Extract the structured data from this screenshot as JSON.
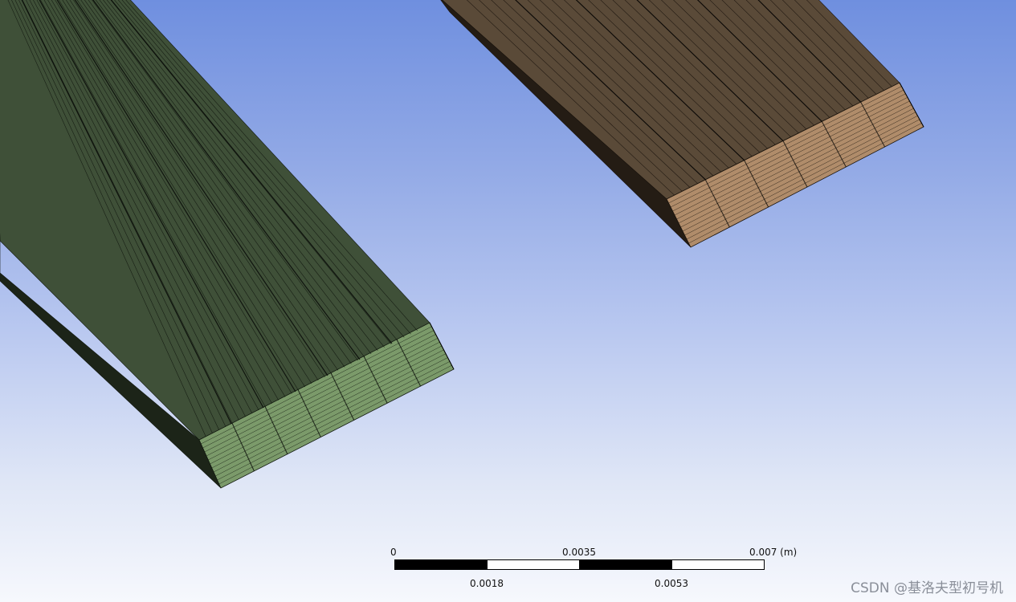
{
  "scene": {
    "objects": [
      {
        "name": "green-body",
        "top_color": "#3f5038",
        "side_color": "#1c2418",
        "end_color": "#7b9a6a",
        "line_color": "#0f150d"
      },
      {
        "name": "tan-body",
        "top_color": "#5a4a38",
        "side_color": "#241c14",
        "end_color": "#b08c6a",
        "line_color": "#17110b"
      }
    ]
  },
  "scale_bar": {
    "top_labels": [
      "0",
      "0.0035",
      "0.007 (m)"
    ],
    "bottom_labels": [
      "0.0018",
      "0.0053"
    ],
    "segment_colors": [
      "#000000",
      "#ffffff",
      "#000000",
      "#ffffff"
    ]
  },
  "watermark": "CSDN @基洛夫型初号机"
}
